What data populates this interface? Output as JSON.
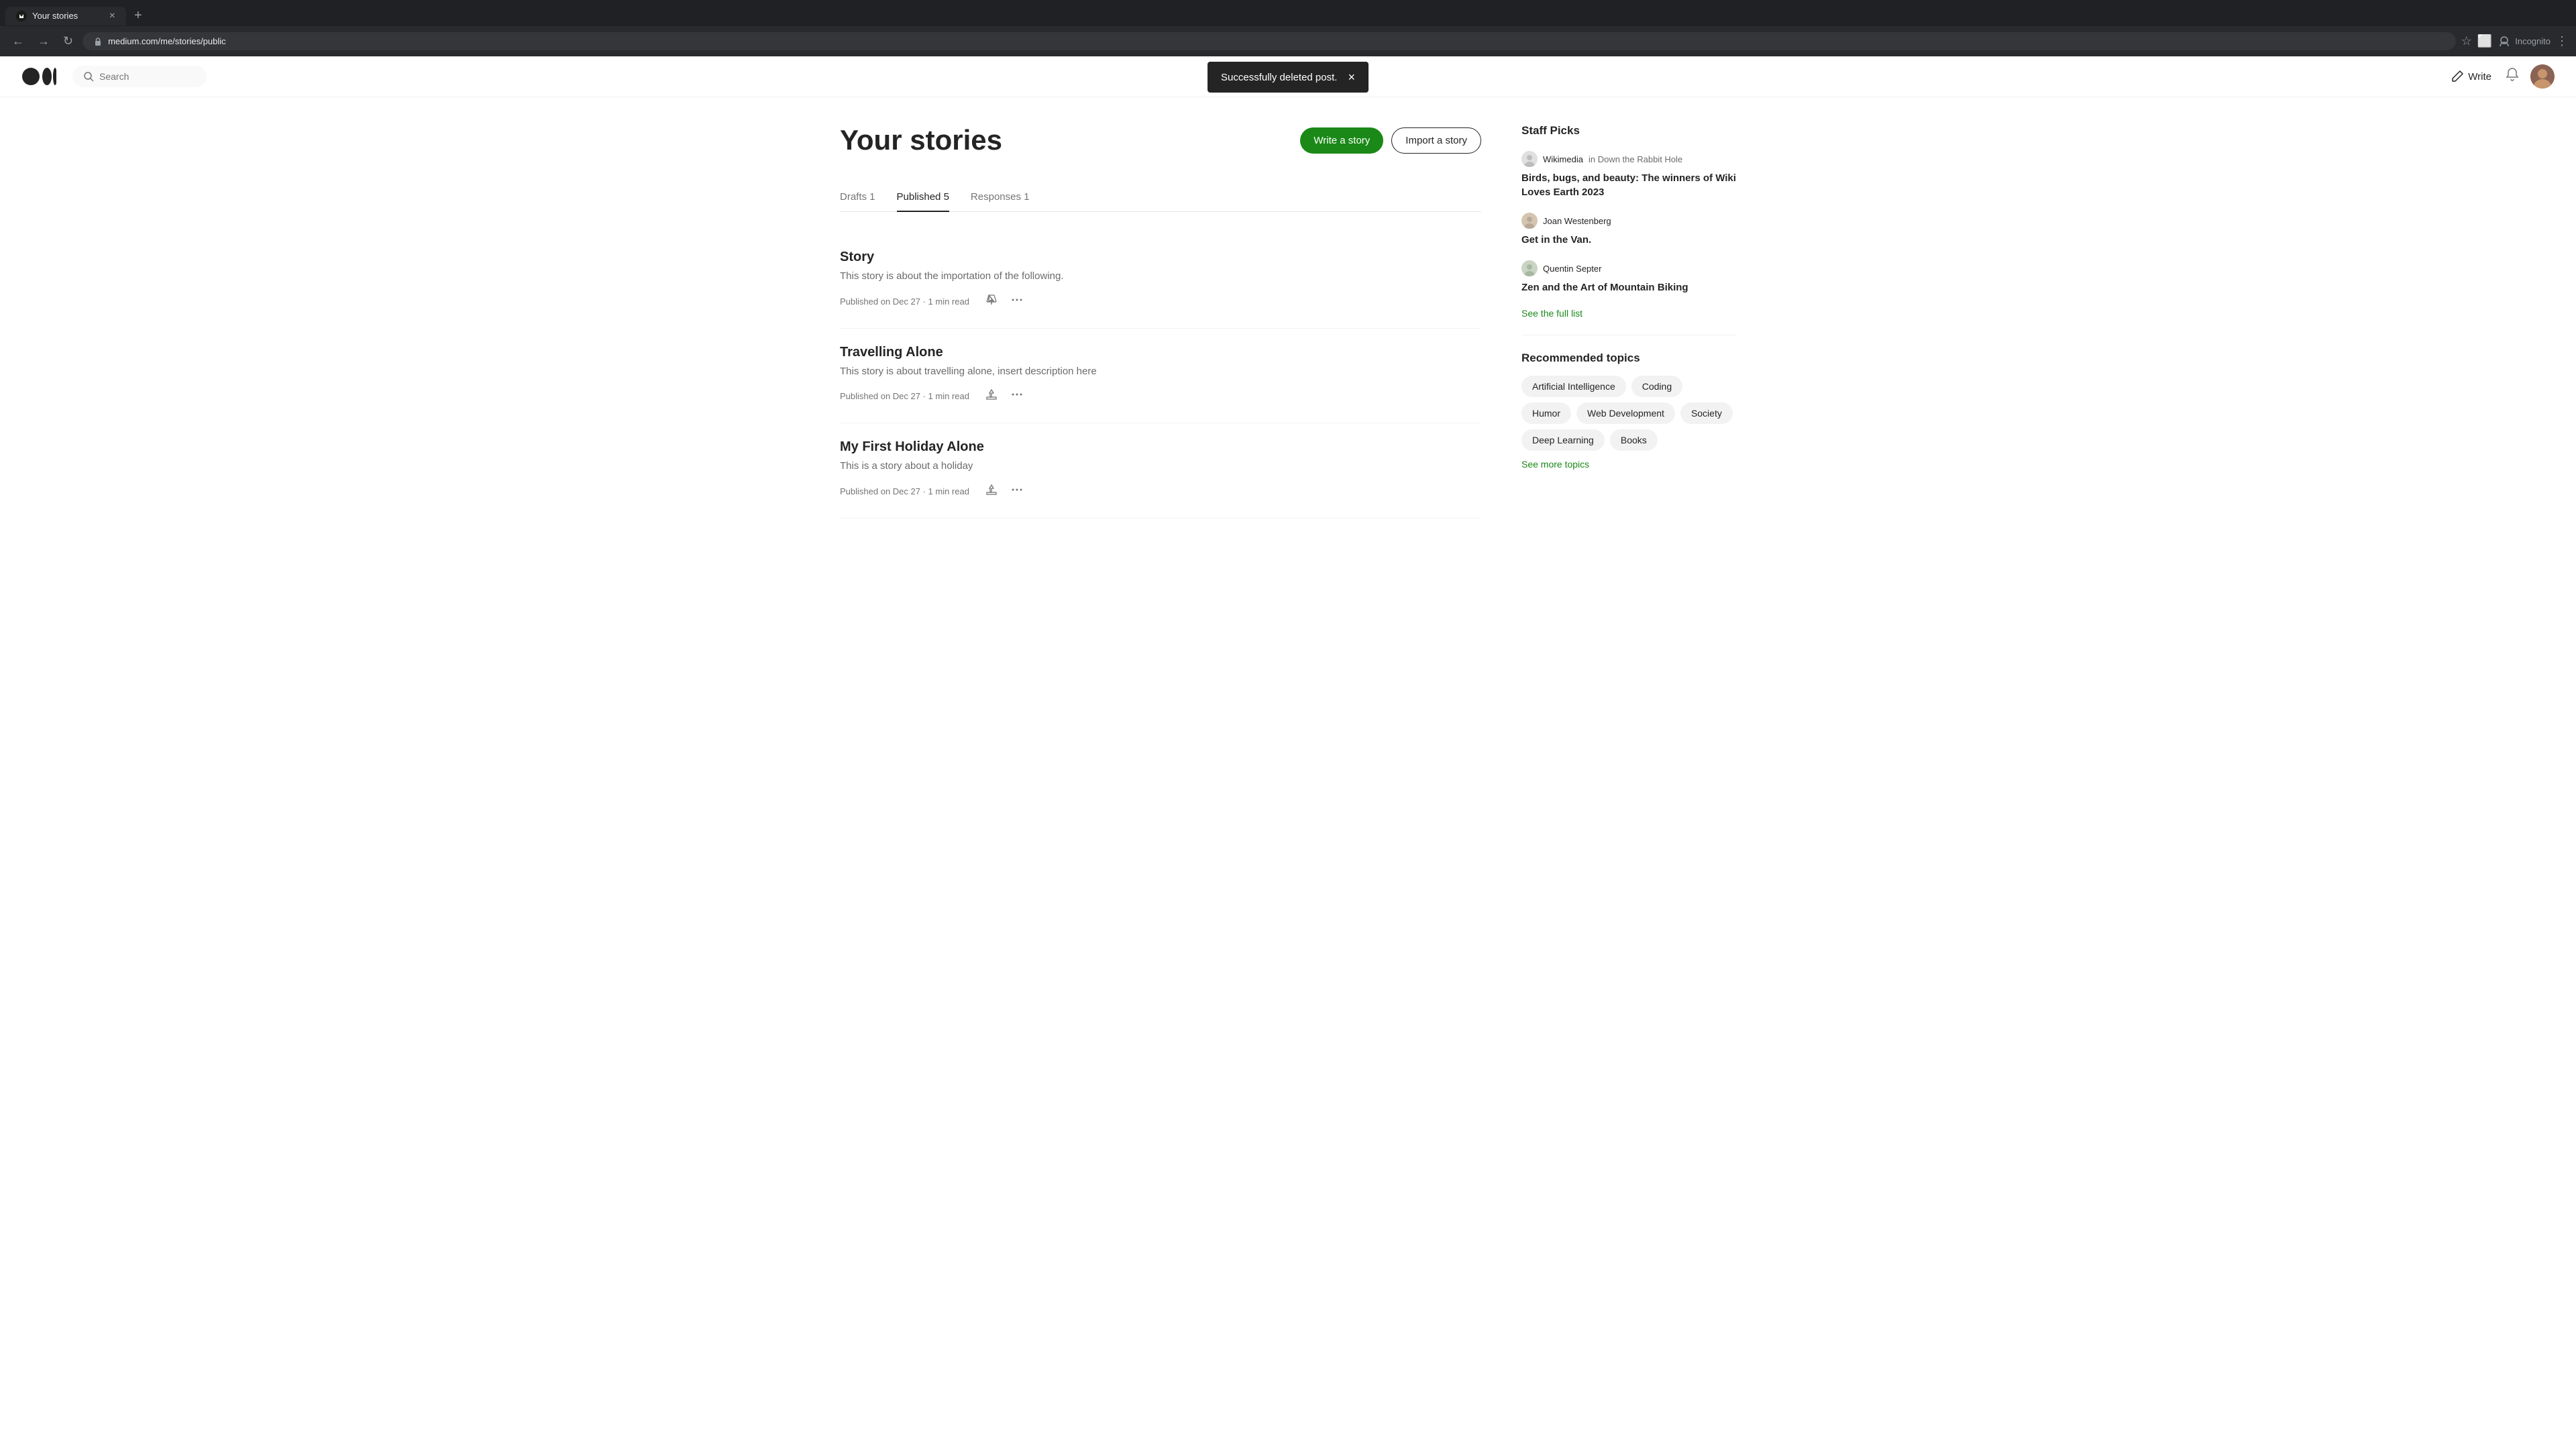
{
  "browser": {
    "tab_label": "Your stories",
    "url": "medium.com/me/stories/public",
    "new_tab_icon": "+",
    "nav": {
      "back": "←",
      "forward": "→",
      "reload": "↻",
      "star": "☆",
      "extensions": "⬜",
      "incognito_label": "Incognito",
      "menu": "⋮"
    }
  },
  "notification": {
    "message": "Successfully deleted post.",
    "close_icon": "×"
  },
  "header": {
    "search_placeholder": "Search",
    "write_label": "Write",
    "write_icon": "✏"
  },
  "page": {
    "title": "Your stories",
    "btn_write": "Write a story",
    "btn_import": "Import a story",
    "tabs": [
      {
        "label": "Drafts 1",
        "active": false
      },
      {
        "label": "Published 5",
        "active": true
      },
      {
        "label": "Responses 1",
        "active": false
      }
    ],
    "stories": [
      {
        "title": "Story",
        "desc": "This story is about the importation of the following.",
        "meta": "Published on Dec 27 · 1 min read"
      },
      {
        "title": "Travelling Alone",
        "desc": "This story is about travelling alone, insert description here",
        "meta": "Published on Dec 27 · 1 min read"
      },
      {
        "title": "My First Holiday Alone",
        "desc": "This is a story about a holiday",
        "meta": "Published on Dec 27 · 1 min read"
      }
    ]
  },
  "sidebar": {
    "staff_picks_title": "Staff Picks",
    "picks": [
      {
        "author": "Wikimedia",
        "publication": "in Down the Rabbit Hole",
        "title": "Birds, bugs, and beauty: The winners of Wiki Loves Earth 2023"
      },
      {
        "author": "Joan Westenberg",
        "publication": "",
        "title": "Get in the Van."
      },
      {
        "author": "Quentin Septer",
        "publication": "",
        "title": "Zen and the Art of Mountain Biking"
      }
    ],
    "see_full_list": "See the full list",
    "rec_topics_title": "Recommended topics",
    "topics": [
      "Artificial Intelligence",
      "Coding",
      "Humor",
      "Web Development",
      "Society",
      "Deep Learning",
      "Books"
    ],
    "see_more_topics": "See more topics"
  }
}
